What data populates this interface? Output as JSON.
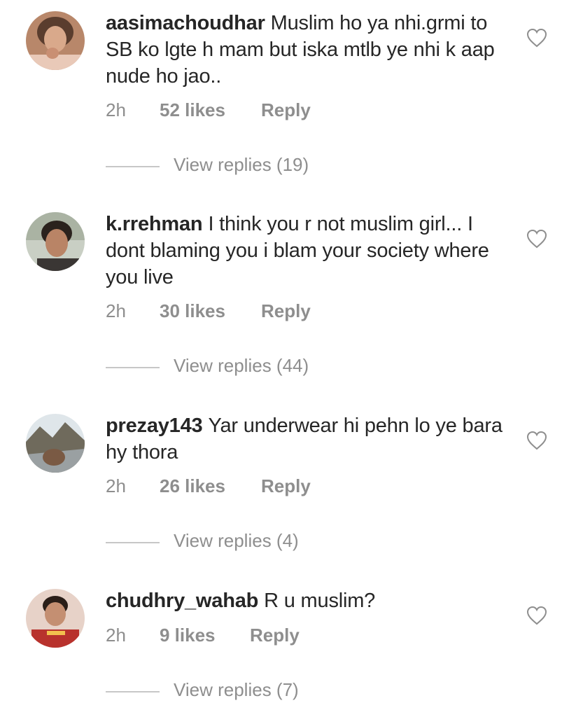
{
  "comments": [
    {
      "username": "aasimachoudhar",
      "text": "Muslim ho ya nhi.grmi to SB ko lgte h mam but iska mtlb ye nhi k aap nude ho jao..",
      "time": "2h",
      "likes": "52 likes",
      "reply": "Reply",
      "view_replies": "View replies (19)",
      "icon": "heart-outline-icon"
    },
    {
      "username": "k.rrehman",
      "text": "I think you r not muslim girl... I dont blaming you i blam your society where you live",
      "time": "2h",
      "likes": "30 likes",
      "reply": "Reply",
      "view_replies": "View replies (44)",
      "icon": "heart-outline-icon"
    },
    {
      "username": "prezay143",
      "text": "Yar underwear hi pehn lo ye bara hy thora",
      "time": "2h",
      "likes": "26 likes",
      "reply": "Reply",
      "view_replies": "View replies (4)",
      "icon": "heart-outline-icon"
    },
    {
      "username": "chudhry_wahab",
      "text": "R u muslim?",
      "time": "2h",
      "likes": "9 likes",
      "reply": "Reply",
      "view_replies": "View replies (7)",
      "icon": "heart-outline-icon"
    }
  ],
  "colors": {
    "text": "#262626",
    "meta": "#8e8e8e",
    "divider": "#c7c7c7",
    "background": "#ffffff"
  }
}
